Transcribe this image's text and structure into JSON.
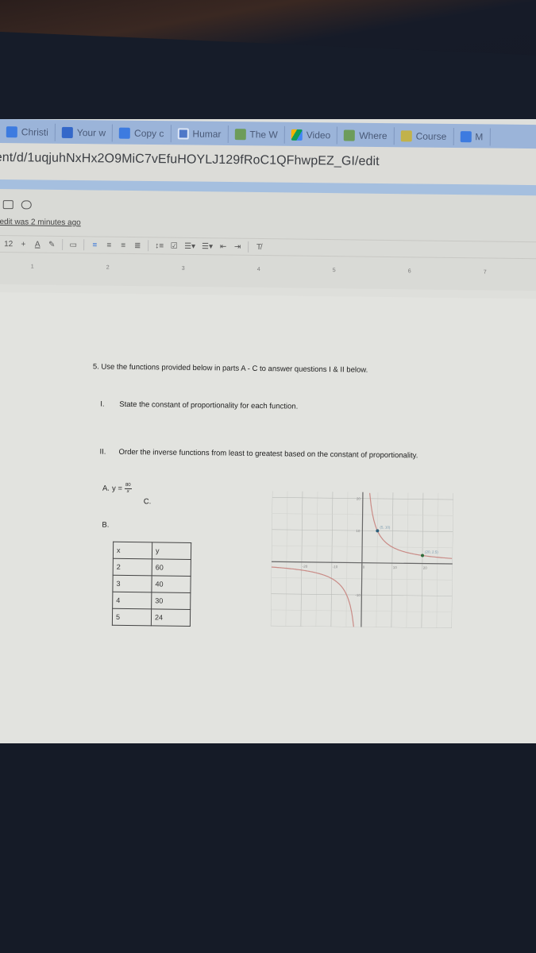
{
  "bookmarks": [
    {
      "label": "Christi",
      "icon": "docs-icon"
    },
    {
      "label": "Your w",
      "icon": "classroom-icon"
    },
    {
      "label": "Copy c",
      "icon": "docs-icon"
    },
    {
      "label": "Humar",
      "icon": "slides-icon"
    },
    {
      "label": "The W",
      "icon": "map-icon"
    },
    {
      "label": "Video",
      "icon": "drive-icon"
    },
    {
      "label": "Where",
      "icon": "map-icon"
    },
    {
      "label": "Course",
      "icon": "course-icon"
    },
    {
      "label": "M",
      "icon": "docs-icon"
    }
  ],
  "url": "ent/d/1uqjuhNxHx2O9MiC7vEfuHOYLJ129fRoC1QFhwpEZ_GI/edit",
  "doc": {
    "last_edit": "edit was 2 minutes ago",
    "font_size": "12",
    "ruler_marks": [
      "1",
      "2",
      "3",
      "4",
      "5",
      "6",
      "7"
    ]
  },
  "question": {
    "intro": "5. Use the functions provided below in parts A - C to answer questions I & II below.",
    "part1_num": "I.",
    "part1_text": "State the constant of proportionality for each function.",
    "part2_num": "II.",
    "part2_text": "Order the inverse functions from least to greatest based on the constant of proportionality.",
    "a_label": "A.",
    "a_equation_lhs": "y =",
    "a_numerator": "80",
    "a_denominator": "x",
    "b_label": "B.",
    "c_label": "C."
  },
  "table_b": {
    "headers": [
      "x",
      "y"
    ],
    "rows": [
      [
        "2",
        "60"
      ],
      [
        "3",
        "40"
      ],
      [
        "4",
        "30"
      ],
      [
        "5",
        "24"
      ]
    ]
  },
  "chart_data": {
    "type": "line",
    "title": "",
    "function": "y = 50/x",
    "points_labeled": [
      {
        "x": 5,
        "y": 10,
        "label": "(5, 10)"
      },
      {
        "x": 20,
        "y": 2.5,
        "label": "(20, 2.5)"
      }
    ],
    "x_ticks": [
      -20,
      -10,
      0,
      10,
      20
    ],
    "y_ticks": [
      -10,
      10,
      20
    ],
    "xlim": [
      -30,
      30
    ],
    "ylim": [
      -20,
      22
    ],
    "grid": true
  }
}
